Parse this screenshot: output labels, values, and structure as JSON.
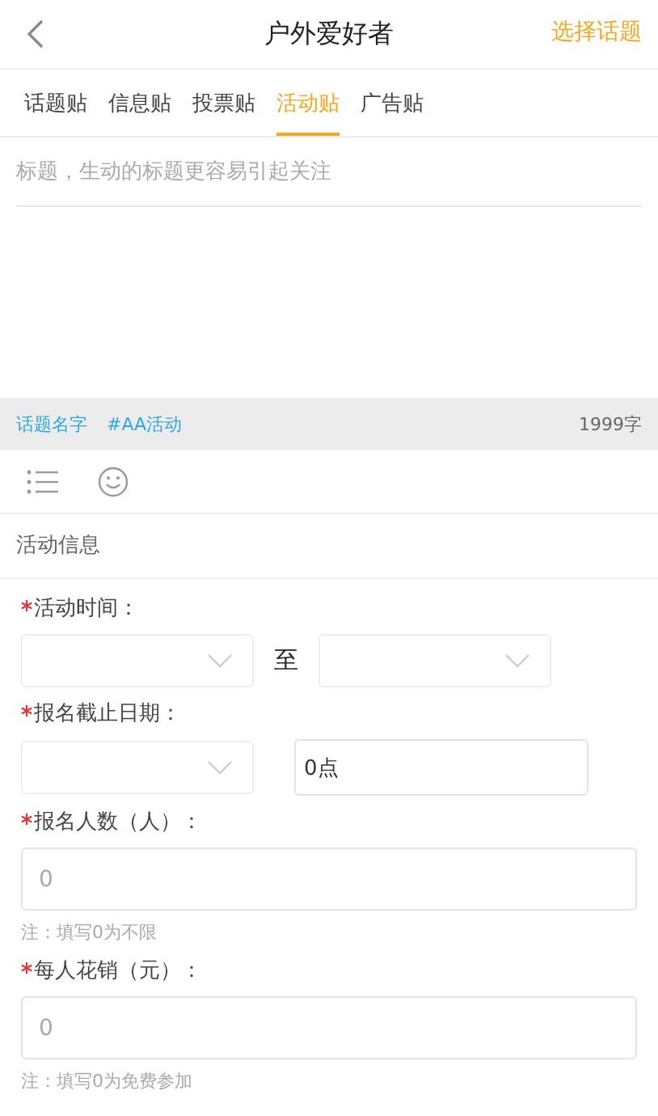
{
  "header": {
    "title": "户外爱好者",
    "action": "选择话题"
  },
  "tabs": [
    {
      "label": "话题贴",
      "selected": false
    },
    {
      "label": "信息贴",
      "selected": false
    },
    {
      "label": "投票贴",
      "selected": false
    },
    {
      "label": "活动贴",
      "selected": true
    },
    {
      "label": "广告贴",
      "selected": false
    }
  ],
  "title_field": {
    "placeholder": "标题，生动的标题更容易引起关注"
  },
  "tag_bar": {
    "tags": [
      "话题名字",
      "#AA活动"
    ],
    "count": "1999字"
  },
  "section_title": "活动信息",
  "form": [
    {
      "kind": "range",
      "label": "活动时间：",
      "required": true,
      "separator": "至"
    },
    {
      "kind": "deadline",
      "label": "报名截止日期：",
      "required": true,
      "value": "0点"
    },
    {
      "kind": "number",
      "label": "报名人数（人）：",
      "required": true,
      "placeholder": "0",
      "note": "注：填写0为不限"
    },
    {
      "kind": "number",
      "label": "每人花销（元）：",
      "required": true,
      "placeholder": "0",
      "note": "注：填写0为免费参加"
    }
  ]
}
